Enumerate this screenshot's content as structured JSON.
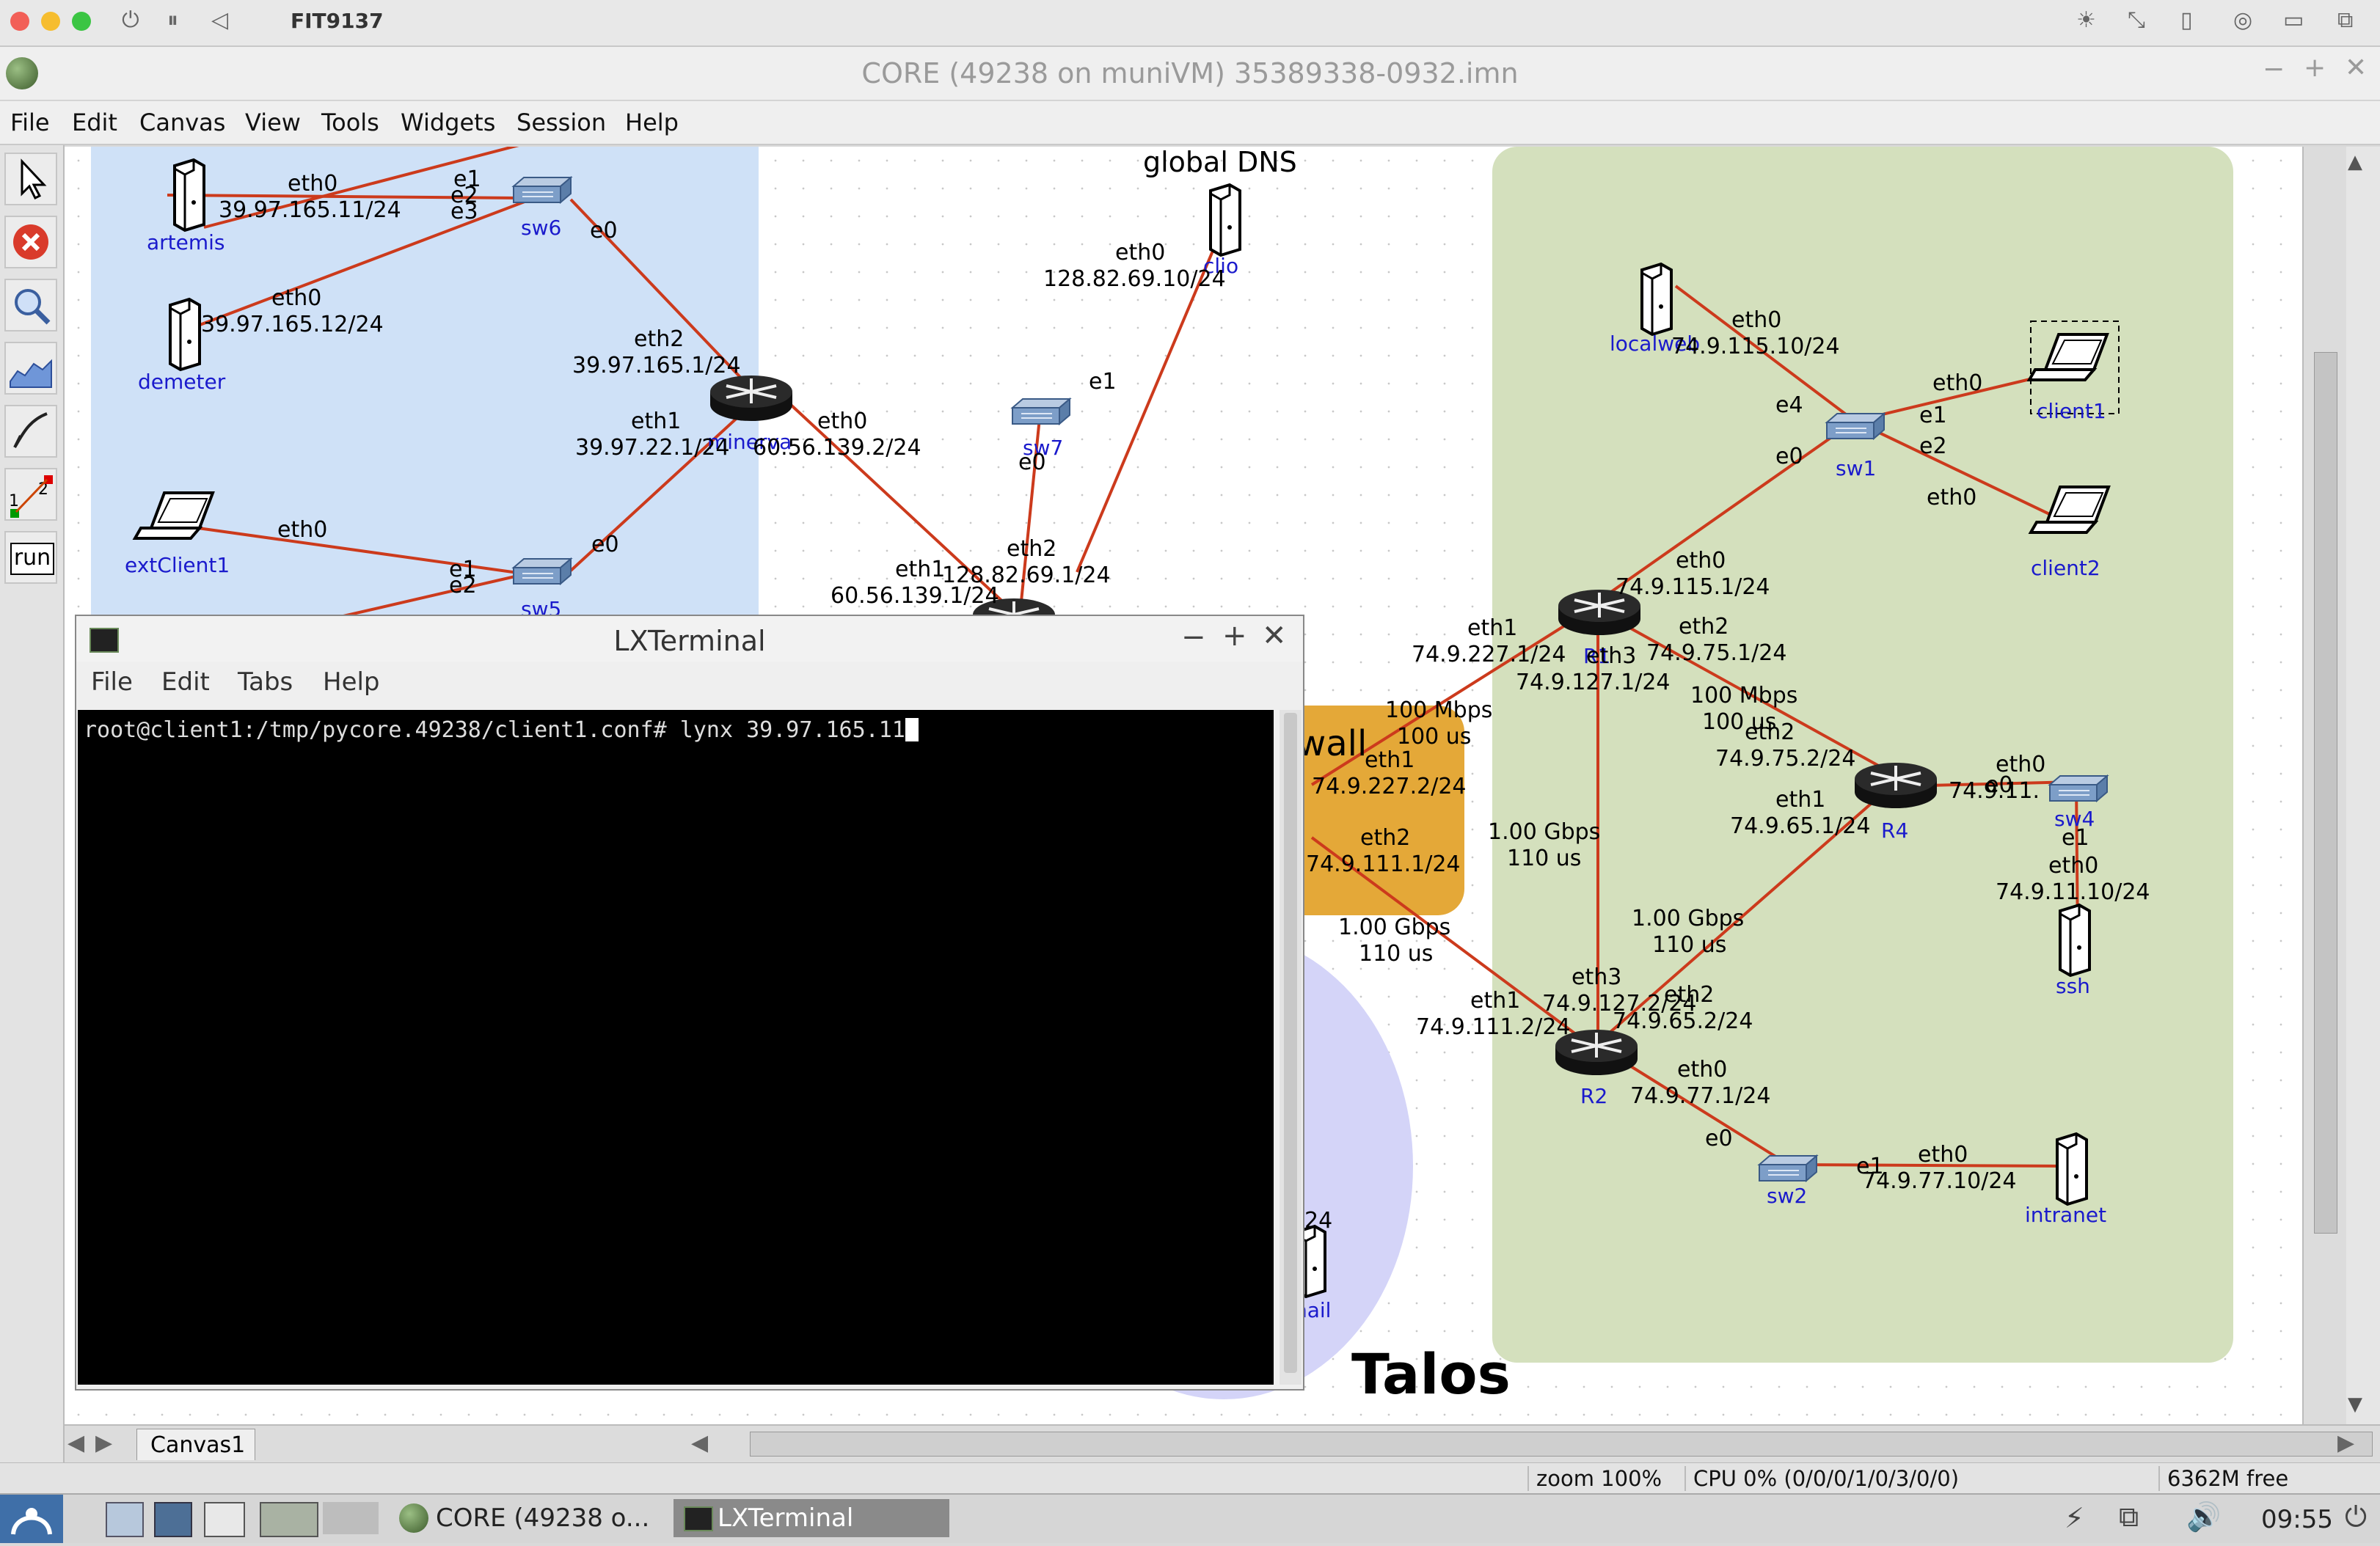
{
  "host": {
    "title": "FIT9137",
    "time": "09:55"
  },
  "window": {
    "title": "CORE (49238 on muniVM) 35389338-0932.imn"
  },
  "menu": [
    "File",
    "Edit",
    "Canvas",
    "View",
    "Tools",
    "Widgets",
    "Session",
    "Help"
  ],
  "toolbar": {
    "run_label": "run",
    "ab_1": "1",
    "ab_2": "2"
  },
  "canvas": {
    "tab": "Canvas1",
    "regions": {
      "talos": "Talos",
      "global_dns": "global DNS",
      "firewall_partial": "wall",
      "mail_partial": "nail",
      "mail_label_partial": "24"
    },
    "nodes": {
      "artemis": "artemis",
      "demeter": "demeter",
      "extClient1": "extClient1",
      "sw6": "sw6",
      "sw5": "sw5",
      "sw7": "sw7",
      "minerva": "minerva",
      "clio": "clio",
      "localweb": "localweb",
      "client1": "client1",
      "client2": "client2",
      "sw1": "sw1",
      "R1": "R1",
      "R2": "R2",
      "R4": "R4",
      "sw4": "sw4",
      "ssh": "ssh",
      "sw2": "sw2",
      "intranet": "intranet"
    },
    "labels": {
      "art_eth0": "eth0",
      "art_ip": "39.97.165.11/24",
      "dem_eth0": "eth0",
      "dem_ip": "39.97.165.12/24",
      "sw6_e1": "e1",
      "sw6_e2": "e2",
      "sw6_e3": "e3",
      "sw6_e0": "e0",
      "min_eth2": "eth2",
      "min_eth2_ip": "39.97.165.1/24",
      "min_eth1": "eth1",
      "min_eth1_ip": "39.97.22.1/24",
      "min_eth0": "eth0",
      "min_eth0_ip": "60.56.139.2/24",
      "ext_eth0": "eth0",
      "sw5_e1": "e1",
      "sw5_e2": "e2",
      "sw5_e0": "e0",
      "clio_eth0": "eth0",
      "clio_ip": "128.82.69.10/24",
      "sw7_e1": "e1",
      "sw7_e0": "e0",
      "fw_eth2": "eth2",
      "fw_eth2_ip": "128.82.69.1/24",
      "fw_eth1": "eth1",
      "fw_eth1_ip": "60.56.139.1/24",
      "lw_eth0": "eth0",
      "lw_ip": "74.9.115.10/24",
      "c1_eth0": "eth0",
      "sw1_e1": "e1",
      "sw1_e2": "e2",
      "sw1_e4": "e4",
      "sw1_e0": "e0",
      "c2_eth0": "eth0",
      "r1_eth0": "eth0",
      "r1_eth0_ip": "74.9.115.1/24",
      "r1_eth1": "eth1",
      "r1_eth1_ip": "74.9.227.1/24",
      "r1_eth3": "eth3",
      "r1_eth3_ip": "74.9.127.1/24",
      "r1_eth2": "eth2",
      "r1_eth2_ip": "74.9.75.1/24",
      "fw_eth1b": "eth1",
      "fw_eth1b_ip": "74.9.227.2/24",
      "fw_eth2b": "eth2",
      "fw_eth2b_ip": "74.9.111.1/24",
      "link1_bw": "100 Mbps",
      "link1_delay": "100 us",
      "link2_bw": "100 Mbps",
      "link2_delay": "100 us",
      "link3_bw": "1.00 Gbps",
      "link3_delay": "110 us",
      "link4_bw": "1.00 Gbps",
      "link4_delay": "110 us",
      "link5_bw": "1.00 Gbps",
      "link5_delay": "110 us",
      "r4_eth2": "eth2",
      "r4_eth2_ip": "74.9.75.2/24",
      "r4_eth1": "eth1",
      "r4_eth1_ip": "74.9.65.1/24",
      "r4_eth0": "eth0",
      "r4_eth0_ip": "74.9.11.",
      "sw4_e0": "e0",
      "sw4_e1": "e1",
      "ssh_eth0": "eth0",
      "ssh_ip": "74.9.11.10/24",
      "r2_eth3": "eth3",
      "r2_eth3_ip": "74.9.127.2/24",
      "r2_eth1": "eth1",
      "r2_eth1_ip": "74.9.111.2/24",
      "r2_eth2": "eth2",
      "r2_eth2_ip": "74.9.65.2/24",
      "r2_eth0": "eth0",
      "r2_eth0_ip": "74.9.77.1/24",
      "sw2_e0": "e0",
      "sw2_e1": "e1",
      "intra_eth0": "eth0",
      "intra_ip": "74.9.77.10/24"
    }
  },
  "status": {
    "zoom": "zoom 100%",
    "cpu": "CPU 0% (0/0/0/1/0/3/0/0)",
    "mem": "6362M free"
  },
  "terminal": {
    "title": "LXTerminal",
    "menu": [
      "File",
      "Edit",
      "Tabs",
      "Help"
    ],
    "prompt": "root@client1:/tmp/pycore.49238/client1.conf# lynx 39.97.165.11"
  },
  "taskbar": {
    "core_task": "CORE (49238 o...",
    "term_task": "LXTerminal"
  },
  "colors": {
    "link": "#cc3a1c",
    "left_region": "#cfe1f7",
    "right_region": "#d4e0bd",
    "firewall": "#e4a838",
    "mail_region": "#d4d4f8",
    "node_label": "#1a1acc"
  }
}
